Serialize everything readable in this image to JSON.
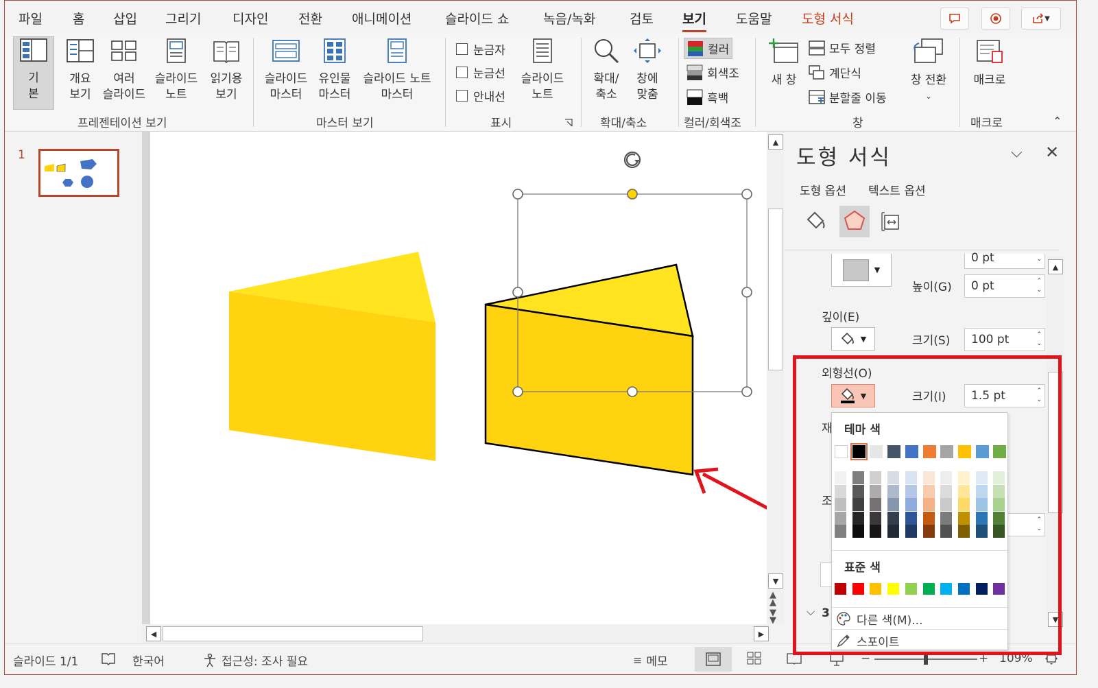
{
  "tabs": [
    "파일",
    "홈",
    "삽입",
    "그리기",
    "디자인",
    "전환",
    "애니메이션",
    "슬라이드 쇼",
    "녹음/녹화",
    "검토",
    "보기",
    "도움말",
    "도형 서식"
  ],
  "active_tab": "보기",
  "ribbon": {
    "presentation_views": {
      "label": "프레젠테이션 보기",
      "normal": "기\n본",
      "outline": "개요\n보기",
      "slide_sorter": "여러\n슬라이드",
      "notes_page": "슬라이드\n노트",
      "reading": "읽기용\n보기"
    },
    "master_views": {
      "label": "마스터 보기",
      "slide_master": "슬라이드\n마스터",
      "handout_master": "유인물\n마스터",
      "notes_master": "슬라이드 노트\n마스터"
    },
    "show": {
      "label": "표시",
      "ruler": "눈금자",
      "gridlines": "눈금선",
      "guides": "안내선",
      "notes": "슬라이드\n노트"
    },
    "zoom": {
      "label": "확대/축소",
      "zoom": "확대/\n축소",
      "fit": "창에\n맞춤"
    },
    "color": {
      "label": "컬러/회색조",
      "color": "컬러",
      "grayscale": "회색조",
      "bw": "흑백"
    },
    "window": {
      "label": "창",
      "new_window": "새 창",
      "arrange_all": "모두 정렬",
      "cascade": "계단식",
      "move_split": "분할줄 이동",
      "switch": "창 전환"
    },
    "macros": {
      "label": "매크로",
      "macros": "매크로"
    }
  },
  "thumbnails": [
    {
      "number": "1"
    }
  ],
  "pane": {
    "title": "도형 서식",
    "tab_shape": "도형 옵션",
    "tab_text": "텍스트 옵션",
    "partial_top": "0 pt",
    "height_label": "높이(G)",
    "height_value": "0 pt",
    "depth_label": "깊이(E)",
    "size_s_label": "크기(S)",
    "size_s_value": "100 pt",
    "contour_label": "외형선(O)",
    "size_i_label": "크기(I)",
    "size_i_value": "1.5 pt",
    "partial_material": "재",
    "partial_lighting": "조",
    "partial_3d": "3"
  },
  "color_menu": {
    "theme_header": "테마 색",
    "standard_header": "표준 색",
    "more_colors": "다른 색(M)...",
    "eyedropper": "스포이트",
    "theme_row": [
      "#ffffff",
      "#000000",
      "#e7e6e6",
      "#44546a",
      "#4472c4",
      "#ed7d31",
      "#a5a5a5",
      "#ffc000",
      "#5b9bd5",
      "#70ad47"
    ],
    "theme_shades": [
      [
        "#f2f2f2",
        "#d9d9d9",
        "#bfbfbf",
        "#a6a6a6",
        "#808080"
      ],
      [
        "#7f7f7f",
        "#595959",
        "#404040",
        "#262626",
        "#0d0d0d"
      ],
      [
        "#d0cece",
        "#aeabab",
        "#757171",
        "#3a3838",
        "#171616"
      ],
      [
        "#d6dce4",
        "#adb9ca",
        "#8496b0",
        "#333f4f",
        "#222a35"
      ],
      [
        "#d9e2f3",
        "#b4c7e7",
        "#8faadc",
        "#2f5597",
        "#1f3864"
      ],
      [
        "#fbe5d6",
        "#f8cbad",
        "#f4b183",
        "#c55a11",
        "#843c0c"
      ],
      [
        "#ededed",
        "#dbdbdb",
        "#c9c9c9",
        "#7b7b7b",
        "#525252"
      ],
      [
        "#fff2cc",
        "#ffe699",
        "#ffd966",
        "#bf9000",
        "#7f6000"
      ],
      [
        "#deebf7",
        "#bdd7ee",
        "#9dc3e6",
        "#2e75b6",
        "#1f4e79"
      ],
      [
        "#e2f0d9",
        "#c5e0b4",
        "#a9d18e",
        "#538135",
        "#375623"
      ]
    ],
    "standard_row": [
      "#c00000",
      "#ff0000",
      "#ffc000",
      "#ffff00",
      "#92d050",
      "#00b050",
      "#00b0f0",
      "#0070c0",
      "#002060",
      "#7030a0"
    ]
  },
  "status": {
    "slide": "슬라이드 1/1",
    "language": "한국어",
    "accessibility": "접근성: 조사 필요",
    "notes": "메모",
    "zoom": "109%"
  },
  "colors": {
    "accent": "#b7472a",
    "context_tab": "#c43e1c",
    "cheese_top": "#ffe41f",
    "cheese_front": "#ffd30f",
    "annotation": "#e1141e"
  }
}
